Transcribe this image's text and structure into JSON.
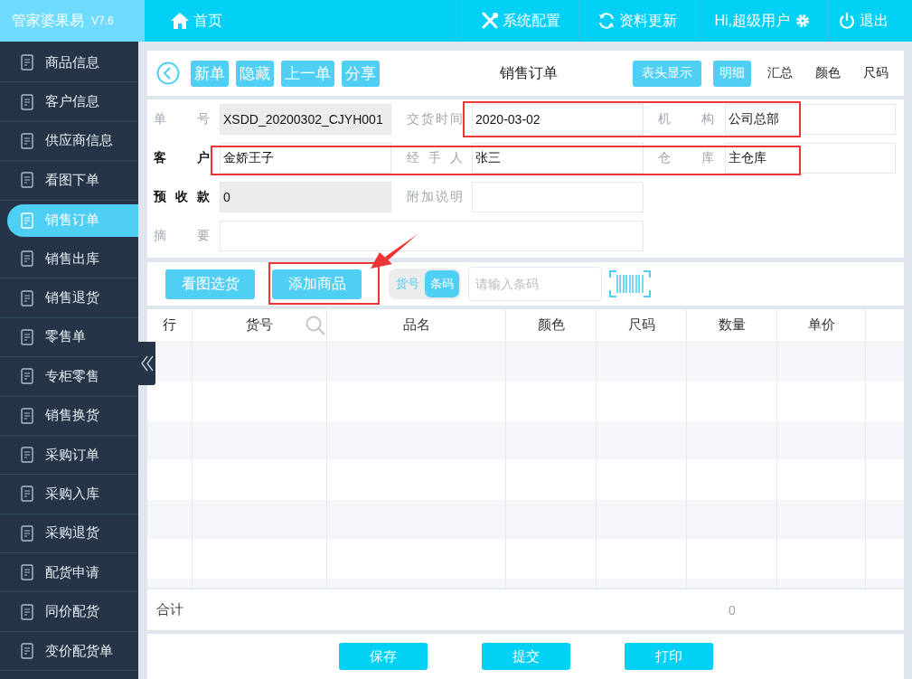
{
  "app": {
    "name": "管家婆果易",
    "version": "V7.6"
  },
  "nav": {
    "home": "首页",
    "items": [
      {
        "kind": "tools",
        "label": "系统配置"
      },
      {
        "kind": "refresh",
        "label": "资料更新"
      }
    ],
    "user": "Hi,超级用户",
    "logout": "退出"
  },
  "sidebar": {
    "items": [
      {
        "label": "商品信息",
        "selected": false
      },
      {
        "label": "客户信息",
        "selected": false
      },
      {
        "label": "供应商信息",
        "selected": false
      },
      {
        "label": "看图下单",
        "selected": false
      },
      {
        "label": "销售订单",
        "selected": true
      },
      {
        "label": "销售出库",
        "selected": false
      },
      {
        "label": "销售退货",
        "selected": false
      },
      {
        "label": "零售单",
        "selected": false
      },
      {
        "label": "专柜零售",
        "selected": false
      },
      {
        "label": "销售换货",
        "selected": false
      },
      {
        "label": "采购订单",
        "selected": false
      },
      {
        "label": "采购入库",
        "selected": false
      },
      {
        "label": "采购退货",
        "selected": false
      },
      {
        "label": "配货申请",
        "selected": false
      },
      {
        "label": "同价配货",
        "selected": false
      },
      {
        "label": "变价配货单",
        "selected": false
      }
    ]
  },
  "toolbar": {
    "buttons": [
      "新单",
      "隐藏",
      "上一单",
      "分享"
    ],
    "title": "销售订单",
    "header_toggle": "表头显示",
    "views": [
      {
        "label": "明细",
        "selected": true
      },
      {
        "label": "汇总",
        "selected": false
      },
      {
        "label": "颜色",
        "selected": false
      },
      {
        "label": "尺码",
        "selected": false
      }
    ]
  },
  "form": {
    "rows": [
      [
        {
          "kind": "text",
          "label": "单号",
          "value": "XSDD_20200302_CJYH001",
          "required": false,
          "readonly": true
        },
        {
          "kind": "text",
          "label": "交货时间",
          "value": "2020-03-02",
          "required": false,
          "readonly": false
        },
        {
          "kind": "text",
          "label": "机构",
          "value": "公司总部",
          "required": false,
          "readonly": false
        }
      ],
      [
        {
          "kind": "text",
          "label": "客户",
          "value": "金娇王子",
          "required": true,
          "readonly": false
        },
        {
          "kind": "text",
          "label": "经手人",
          "value": "张三",
          "required": false,
          "readonly": false
        },
        {
          "kind": "text",
          "label": "仓库",
          "value": "主仓库",
          "required": false,
          "readonly": false
        }
      ],
      [
        {
          "kind": "text",
          "label": "预收款",
          "value": "0",
          "required": true,
          "readonly": true
        },
        {
          "kind": "text",
          "label": "附加说明",
          "required": false,
          "readonly": false
        }
      ],
      [
        {
          "kind": "note",
          "label": "摘要",
          "required": false,
          "readonly": false
        }
      ]
    ]
  },
  "actions": {
    "buttons": [
      "看图选货",
      "添加商品"
    ],
    "search_mode": [
      {
        "label": "货号",
        "selected": false
      },
      {
        "label": "条码",
        "selected": true
      }
    ],
    "barcode": {
      "placeholder": "请输入条码"
    }
  },
  "table": {
    "columns": [
      "行",
      "货号",
      "品名",
      "颜色",
      "尺码",
      "数量",
      "单价"
    ],
    "total": {
      "label": "合计",
      "quantity": "0"
    }
  },
  "footer": {
    "buttons": [
      "保存",
      "提交",
      "打印"
    ]
  }
}
